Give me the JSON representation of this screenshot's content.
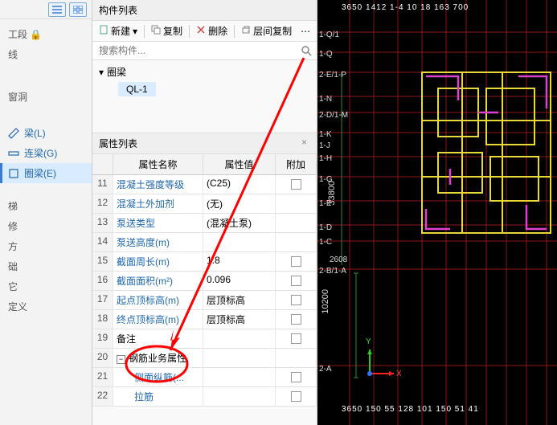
{
  "left": {
    "items": [
      {
        "label": "工段 🔒",
        "iconless": true
      },
      {
        "label": "线",
        "iconless": true
      },
      {
        "label": "窗洞",
        "iconless": true
      },
      {
        "label": "梁(L)",
        "blue": true,
        "icon": "beam-icon"
      },
      {
        "label": "连梁(G)",
        "blue": true,
        "icon": "link-beam-icon"
      },
      {
        "label": "圈梁(E)",
        "blue": true,
        "icon": "ring-beam-icon",
        "active": true
      },
      {
        "label": "梯",
        "iconless": true
      },
      {
        "label": "修",
        "iconless": true
      },
      {
        "label": "方",
        "iconless": true
      },
      {
        "label": "础",
        "iconless": true
      },
      {
        "label": "它",
        "iconless": true
      },
      {
        "label": "定义",
        "iconless": true
      }
    ]
  },
  "mid": {
    "title": "构件列表",
    "toolbar": {
      "new": "新建",
      "copy": "复制",
      "delete": "删除",
      "layerCopy": "层间复制"
    },
    "searchPlaceholder": "搜索构件...",
    "treeParent": "圈梁",
    "treeChild": "QL-1",
    "propTitle": "属性列表",
    "header": {
      "name": "属性名称",
      "value": "属性值",
      "extra": "附加"
    },
    "rows": [
      {
        "n": "11",
        "name": "混凝土强度等级",
        "val": "(C25)",
        "chk": true
      },
      {
        "n": "12",
        "name": "混凝土外加剂",
        "val": "(无)",
        "chk": false
      },
      {
        "n": "13",
        "name": "泵送类型",
        "val": "(混凝土泵)",
        "chk": false
      },
      {
        "n": "14",
        "name": "泵送高度(m)",
        "val": "",
        "chk": false
      },
      {
        "n": "15",
        "name": "截面周长(m)",
        "val": "1.8",
        "chk": true
      },
      {
        "n": "16",
        "name": "截面面积(m²)",
        "val": "0.096",
        "chk": true
      },
      {
        "n": "17",
        "name": "起点顶标高(m)",
        "val": "层顶标高",
        "chk": true
      },
      {
        "n": "18",
        "name": "终点顶标高(m)",
        "val": "层顶标高",
        "chk": true
      },
      {
        "n": "19",
        "name": "备注",
        "val": "",
        "chk": true
      },
      {
        "n": "20",
        "name": "钢筋业务属性",
        "val": "",
        "group": true
      },
      {
        "n": "21",
        "name": "侧面纵筋(...",
        "val": "",
        "chk": true,
        "indent": true
      },
      {
        "n": "22",
        "name": "拉筋",
        "val": "",
        "chk": true,
        "indent": true
      }
    ]
  },
  "canvas": {
    "topRuler": "3650 1412 1-4 10 18 163 700",
    "botRuler": "3650 150 55 128 101 150 51 41",
    "yLabels": [
      "1-Q/1",
      "1-Q",
      "2-E/1-P",
      "1-N",
      "2-D/1-M",
      "1-K",
      "1-J",
      "1-H",
      "1-G",
      "1-E",
      "1-D",
      "1-C",
      "2-B/1-A",
      "2-A"
    ],
    "dim1": "10200",
    "dim2": "33800",
    "dim3": "2608",
    "xAxis": "X",
    "yAxis": "Y"
  }
}
